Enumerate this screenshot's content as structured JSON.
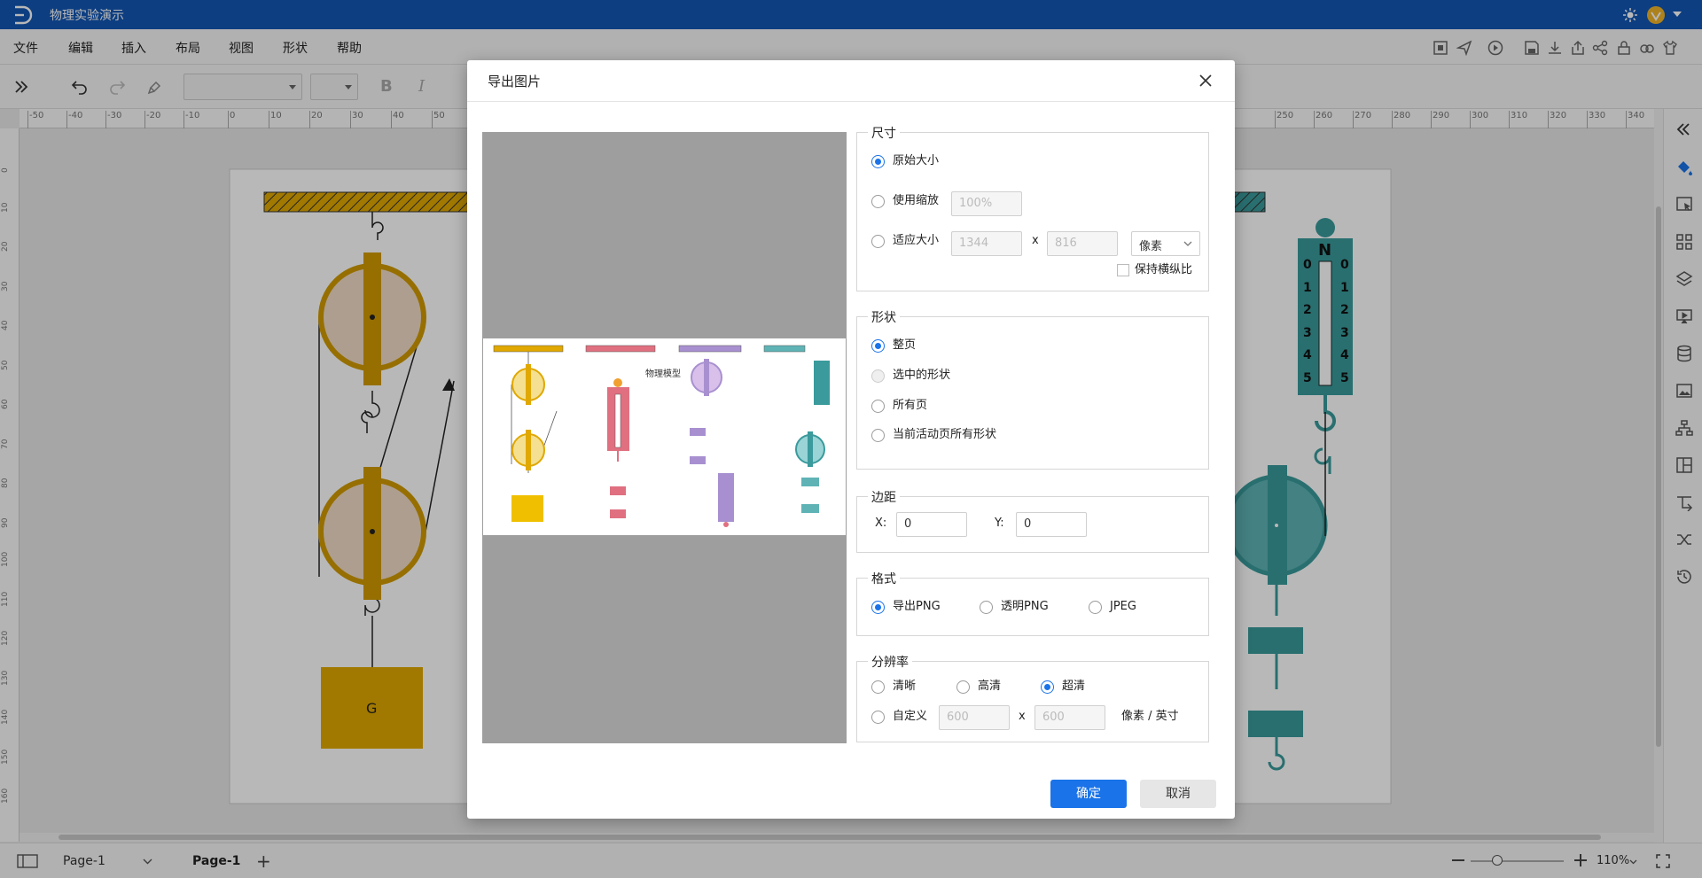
{
  "app": {
    "title": "物理实验演示"
  },
  "menu": {
    "items": [
      "文件",
      "编辑",
      "插入",
      "布局",
      "视图",
      "形状",
      "帮助"
    ]
  },
  "toolbar": {
    "bold": "B",
    "italic": "I"
  },
  "ruler": {
    "h_ticks": [
      "-50",
      "-40",
      "-30",
      "-20",
      "-10",
      "0",
      "10",
      "20",
      "30",
      "40",
      "50",
      "250",
      "260",
      "270",
      "280",
      "290",
      "300",
      "310",
      "320",
      "330",
      "340"
    ],
    "v_ticks": [
      "0",
      "10",
      "20",
      "30",
      "40",
      "50",
      "60",
      "70",
      "80",
      "90",
      "100",
      "110",
      "120",
      "130",
      "140",
      "150",
      "160"
    ]
  },
  "canvas": {
    "g_label": "G",
    "scale_n": "N",
    "scale_ticks": [
      "0",
      "1",
      "2",
      "3",
      "4",
      "5"
    ]
  },
  "preview": {
    "label": "物理模型"
  },
  "dialog": {
    "title": "导出图片",
    "size": {
      "legend": "尺寸",
      "original": "原始大小",
      "scale": "使用缩放",
      "scale_value": "100%",
      "fit": "适应大小",
      "fit_w": "1344",
      "fit_h": "816",
      "x": "x",
      "unit": "像素",
      "keep_ratio": "保持横纵比"
    },
    "shape": {
      "legend": "形状",
      "whole": "整页",
      "selected": "选中的形状",
      "all_pages": "所有页",
      "current": "当前活动页所有形状"
    },
    "margin": {
      "legend": "边距",
      "x_label": "X:",
      "x_value": "0",
      "y_label": "Y:",
      "y_value": "0"
    },
    "format": {
      "legend": "格式",
      "png": "导出PNG",
      "transparent": "透明PNG",
      "jpeg": "JPEG"
    },
    "resolution": {
      "legend": "分辨率",
      "clear": "清晰",
      "hd": "高清",
      "uhd": "超清",
      "custom": "自定义",
      "custom_w": "600",
      "custom_h": "600",
      "x": "x",
      "unit": "像素 / 英寸"
    },
    "ok": "确定",
    "cancel": "取消"
  },
  "status": {
    "page_select": "Page-1",
    "page_tab": "Page-1",
    "add": "+",
    "zoom": "110%"
  },
  "colors": {
    "brand": "#1356b3",
    "primary": "#1a73e8",
    "gold": "#e0a800",
    "teal": "#3a9a9c",
    "pink": "#e07080",
    "purple": "#a890d0"
  }
}
